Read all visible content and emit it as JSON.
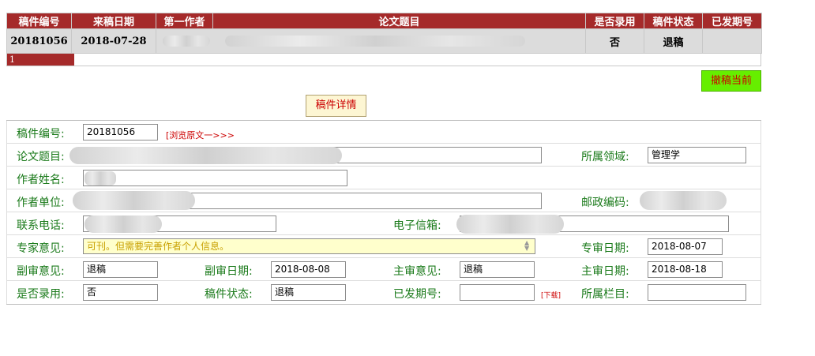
{
  "list": {
    "headers": [
      "稿件编号",
      "来稿日期",
      "第一作者",
      "论文题目",
      "是否录用",
      "稿件状态",
      "已发期号"
    ],
    "row": {
      "manuscript_no": "20181056",
      "date": "2018-07-28",
      "first_author": "",
      "title": "",
      "accepted": "否",
      "status": "退稿",
      "issue": ""
    },
    "page_number": "1"
  },
  "buttons": {
    "withdraw": "撤稿当前",
    "detail": "稿件详情"
  },
  "form": {
    "manuscript_no_label": "稿件编号:",
    "manuscript_no": "20181056",
    "browse_link": "[浏览原文一>>>",
    "title_label": "论文题目:",
    "title": "",
    "field_label": "所属领域:",
    "field": "管理学",
    "author_label": "作者姓名:",
    "author": "",
    "unit_label": "作者单位:",
    "unit": "",
    "postcode_label": "邮政编码:",
    "postcode": "",
    "phone_label": "联系电话:",
    "phone": "",
    "email_label": "电子信箱:",
    "email": "",
    "expert_opinion_label": "专家意见:",
    "expert_opinion": "可刊。但需要完善作者个人信息。",
    "expert_date_label": "专审日期:",
    "expert_date": "2018-08-07",
    "deputy_opinion_label": "副审意见:",
    "deputy_opinion": "退稿",
    "deputy_date_label": "副审日期:",
    "deputy_date": "2018-08-08",
    "chief_opinion_label": "主审意见:",
    "chief_opinion": "退稿",
    "chief_date_label": "主审日期:",
    "chief_date": "2018-08-18",
    "accepted_label": "是否录用:",
    "accepted": "否",
    "status_label": "稿件状态:",
    "status": "退稿",
    "issue_label": "已发期号:",
    "issue": "",
    "download_link": "[下载]",
    "column_label": "所属栏目:",
    "column": ""
  },
  "colors": {
    "header_red": "#a52a2a",
    "label_green": "#1a7a1a",
    "withdraw_green": "#66ee00",
    "link_red": "#cc0000"
  }
}
